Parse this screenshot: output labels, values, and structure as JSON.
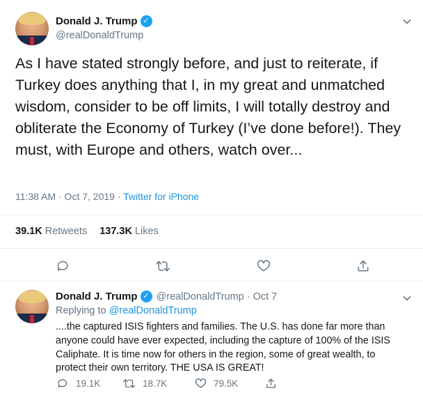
{
  "main_tweet": {
    "author_name": "Donald J. Trump",
    "handle": "@realDonaldTrump",
    "text": "As I have stated strongly before, and just to reiterate, if Turkey does anything that I, in my great and unmatched wisdom, consider to be off limits, I will totally destroy and obliterate the Economy of Turkey (I’ve done before!). They must, with Europe and others, watch over...",
    "timestamp": "11:38 AM · Oct 7, 2019 · ",
    "source": "Twitter for iPhone",
    "retweets_count": "39.1K",
    "retweets_label": "Retweets",
    "likes_count": "137.3K",
    "likes_label": "Likes",
    "icons": [
      "reply-icon",
      "retweet-icon",
      "like-icon",
      "share-icon",
      "verified-badge-icon",
      "chevron-down-icon"
    ]
  },
  "reply_tweet": {
    "author_name": "Donald J. Trump",
    "handle": "@realDonaldTrump",
    "date": "· Oct 7",
    "replying_prefix": "Replying to ",
    "replying_to": "@realDonaldTrump",
    "text": "....the captured ISIS fighters and families. The U.S. has done far more than anyone could have ever expected, including the capture of 100% of the ISIS Caliphate. It is time now for others in the region, some of great wealth, to protect their own territory. THE USA IS GREAT!",
    "reply_count": "19.1K",
    "retweet_count": "18.7K",
    "like_count": "79.5K"
  },
  "colors": {
    "link_blue": "#1b95e0",
    "verified_blue": "#1da1f2",
    "muted_gray": "#657786",
    "text": "#14171a",
    "divider": "#e6ecf0"
  }
}
